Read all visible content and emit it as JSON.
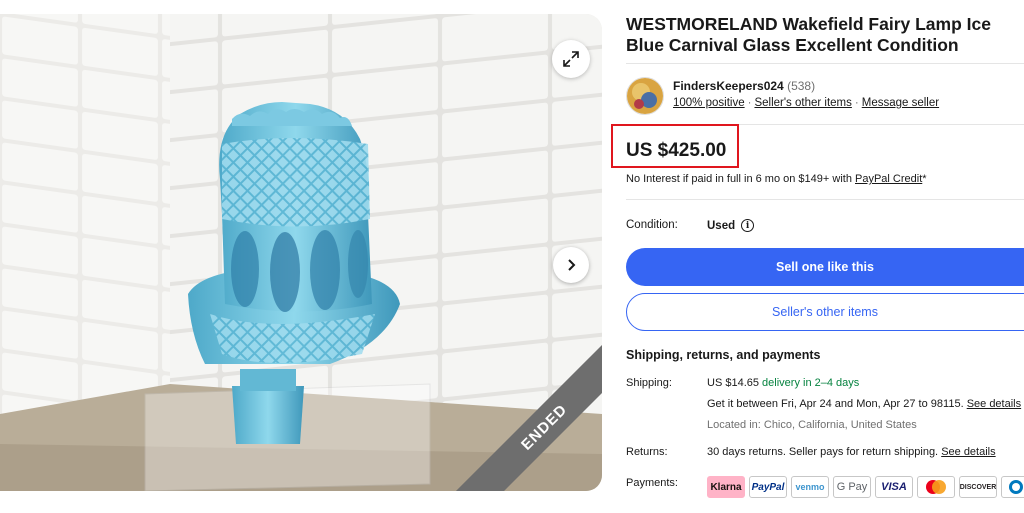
{
  "listing": {
    "title": "WESTMORELAND Wakefield Fairy Lamp Ice Blue Carnival Glass Excellent Condition",
    "ended_label": "ENDED"
  },
  "seller": {
    "name": "FindersKeepers024",
    "feedback_count": "(538)",
    "positive": "100% positive",
    "other_items_link": "Seller's other items",
    "message_link": "Message seller"
  },
  "price": {
    "amount": "US $425.00",
    "financing_prefix": "No Interest if paid in full in 6 mo on $149+ with ",
    "financing_link": "PayPal Credit",
    "financing_suffix": "*"
  },
  "condition": {
    "label": "Condition:",
    "value": "Used"
  },
  "actions": {
    "primary": "Sell one like this",
    "secondary": "Seller's other items"
  },
  "shipping": {
    "heading": "Shipping, returns, and payments",
    "shipping_label": "Shipping:",
    "shipping_cost": "US $14.65 ",
    "delivery": "delivery in 2–4 days",
    "estimate": "Get it between Fri, Apr 24 and Mon, Apr 27 to 98115. ",
    "see_details": "See details",
    "location": "Located in: Chico, California, United States",
    "returns_label": "Returns:",
    "returns_text": "30 days returns. Seller pays for return shipping. ",
    "returns_link": "See details",
    "payments_label": "Payments:"
  },
  "payments": [
    "Klarna",
    "PayPal",
    "venmo",
    "G Pay",
    "VISA",
    "Mastercard",
    "DISCOVER",
    "Diners"
  ],
  "colors": {
    "accent": "#3665f3",
    "price_highlight": "#e0161e",
    "delivery_green": "#05823f",
    "glass": "#5ab8d6"
  },
  "icons": {
    "expand": "expand-icon",
    "next": "chevron-right-icon",
    "info": "info-icon"
  }
}
